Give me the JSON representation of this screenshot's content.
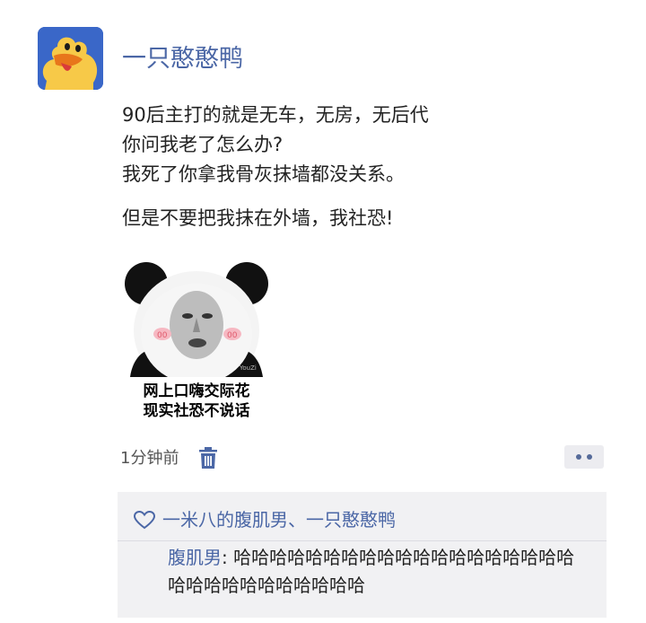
{
  "post": {
    "username": "一只憨憨鸭",
    "lines": [
      "90后主打的就是无车，无房，无后代",
      "你问我老了怎么办?",
      "我死了你拿我骨灰抹墙都没关系。",
      "但是不要把我抹在外墙，我社恐!"
    ],
    "meme": {
      "caption_line1": "网上口嗨交际花",
      "caption_line2": "现实社恐不说话",
      "watermark": "YouZi"
    },
    "time": "1分钟前"
  },
  "comments": {
    "likes": "一米八的腹肌男、一只憨憨鸭",
    "items": [
      {
        "author": "腹肌男",
        "separator": ": ",
        "text": "哈哈哈哈哈哈哈哈哈哈哈哈哈哈哈哈哈哈哈哈哈哈哈哈哈哈哈哈哈哈"
      }
    ]
  },
  "colors": {
    "link": "#4b67a6",
    "avatar_bg": "#3a67c8",
    "comment_bg": "#f1f1f3"
  },
  "icons": [
    "duck-avatar",
    "trash-icon",
    "more-dots-icon",
    "heart-icon"
  ]
}
